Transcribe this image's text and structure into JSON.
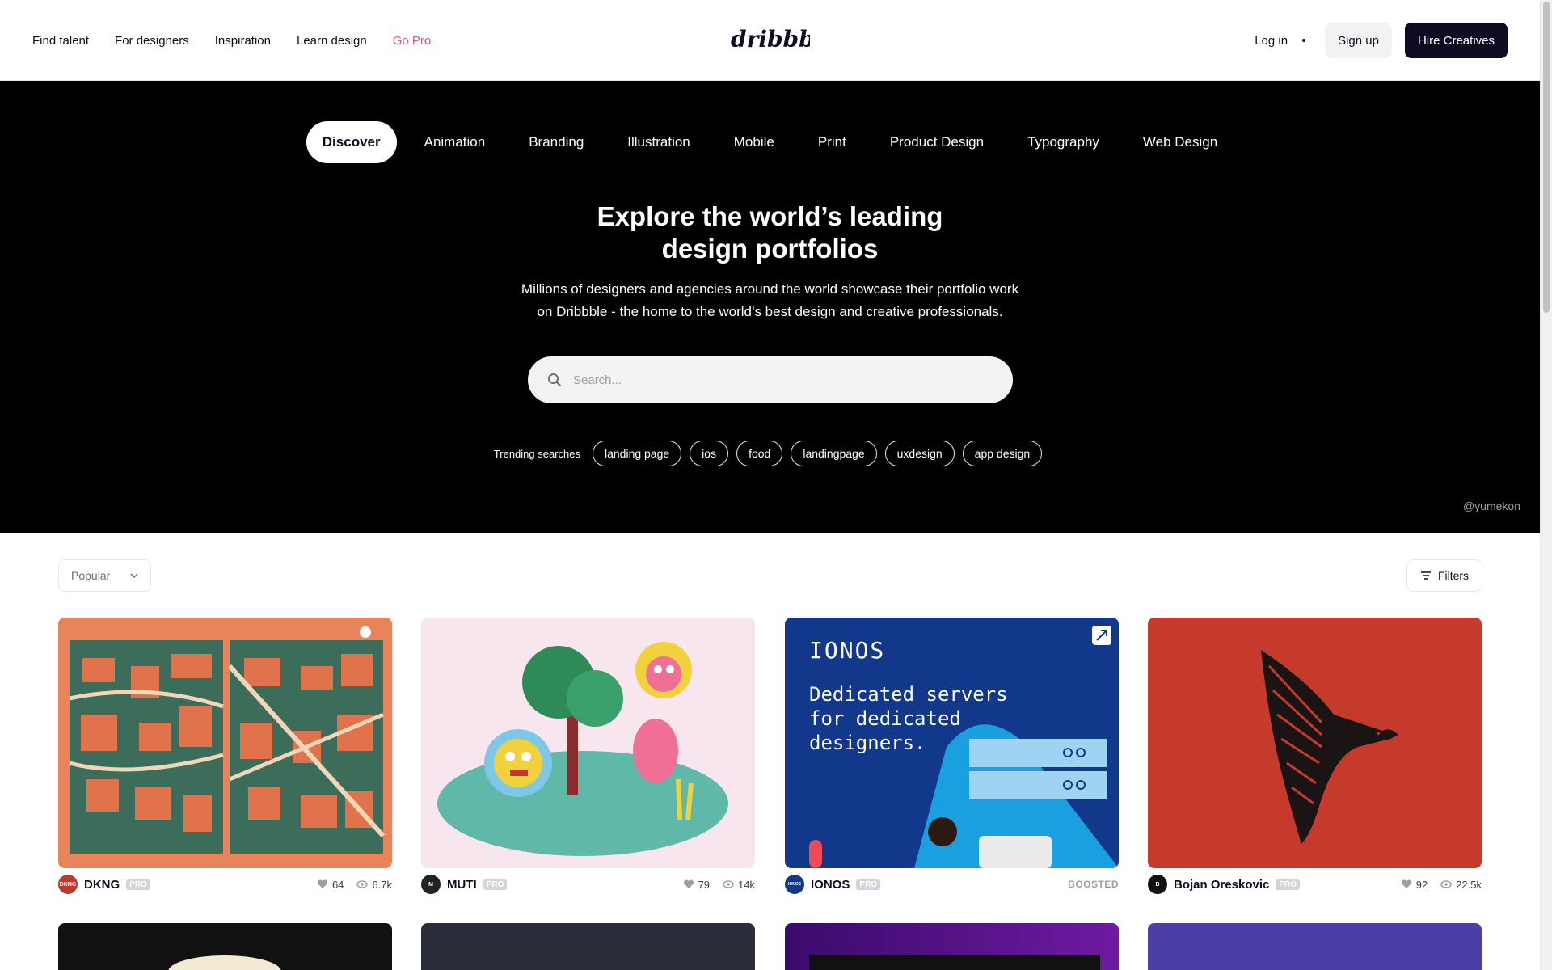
{
  "header": {
    "nav": [
      "Find talent",
      "For designers",
      "Inspiration",
      "Learn design",
      "Go Pro"
    ],
    "logo_text": "dribbble",
    "login": "Log in",
    "signup": "Sign up",
    "hire": "Hire Creatives"
  },
  "hero": {
    "categories": [
      "Discover",
      "Animation",
      "Branding",
      "Illustration",
      "Mobile",
      "Print",
      "Product Design",
      "Typography",
      "Web Design"
    ],
    "active_category": "Discover",
    "title_line1": "Explore the world’s leading",
    "title_line2": "design portfolios",
    "sub_line1": "Millions of designers and agencies around the world showcase their portfolio work",
    "sub_line2": "on Dribbble - the home to the world’s best design and creative professionals.",
    "search_placeholder": "Search...",
    "trending_label": "Trending searches",
    "trending": [
      "landing page",
      "ios",
      "food",
      "landingpage",
      "uxdesign",
      "app design"
    ],
    "credit": "@yumekon"
  },
  "filters": {
    "sort": "Popular",
    "filters_label": "Filters"
  },
  "shots": [
    {
      "name": "DKNG",
      "avatar_text": "DKNG",
      "avatar_color": "#c0392b",
      "badge": "PRO",
      "likes": "64",
      "views": "6.7k"
    },
    {
      "name": "MUTI",
      "avatar_text": "M",
      "avatar_color": "#222222",
      "badge": "PRO",
      "likes": "79",
      "views": "14k"
    },
    {
      "name": "IONOS",
      "avatar_text": "IONOS",
      "avatar_color": "#11388b",
      "badge": "PRO",
      "boosted": "BOOSTED",
      "ad_brand": "IONOS",
      "ad_line1": "Dedicated servers",
      "ad_line2": "for dedicated",
      "ad_line3": "designers."
    },
    {
      "name": "Bojan Oreskovic",
      "avatar_text": "B",
      "avatar_color": "#111111",
      "badge": "PRO",
      "likes": "92",
      "views": "22.5k"
    }
  ],
  "colors": {
    "accent": "#ea4c89",
    "dark": "#0d0c22"
  }
}
